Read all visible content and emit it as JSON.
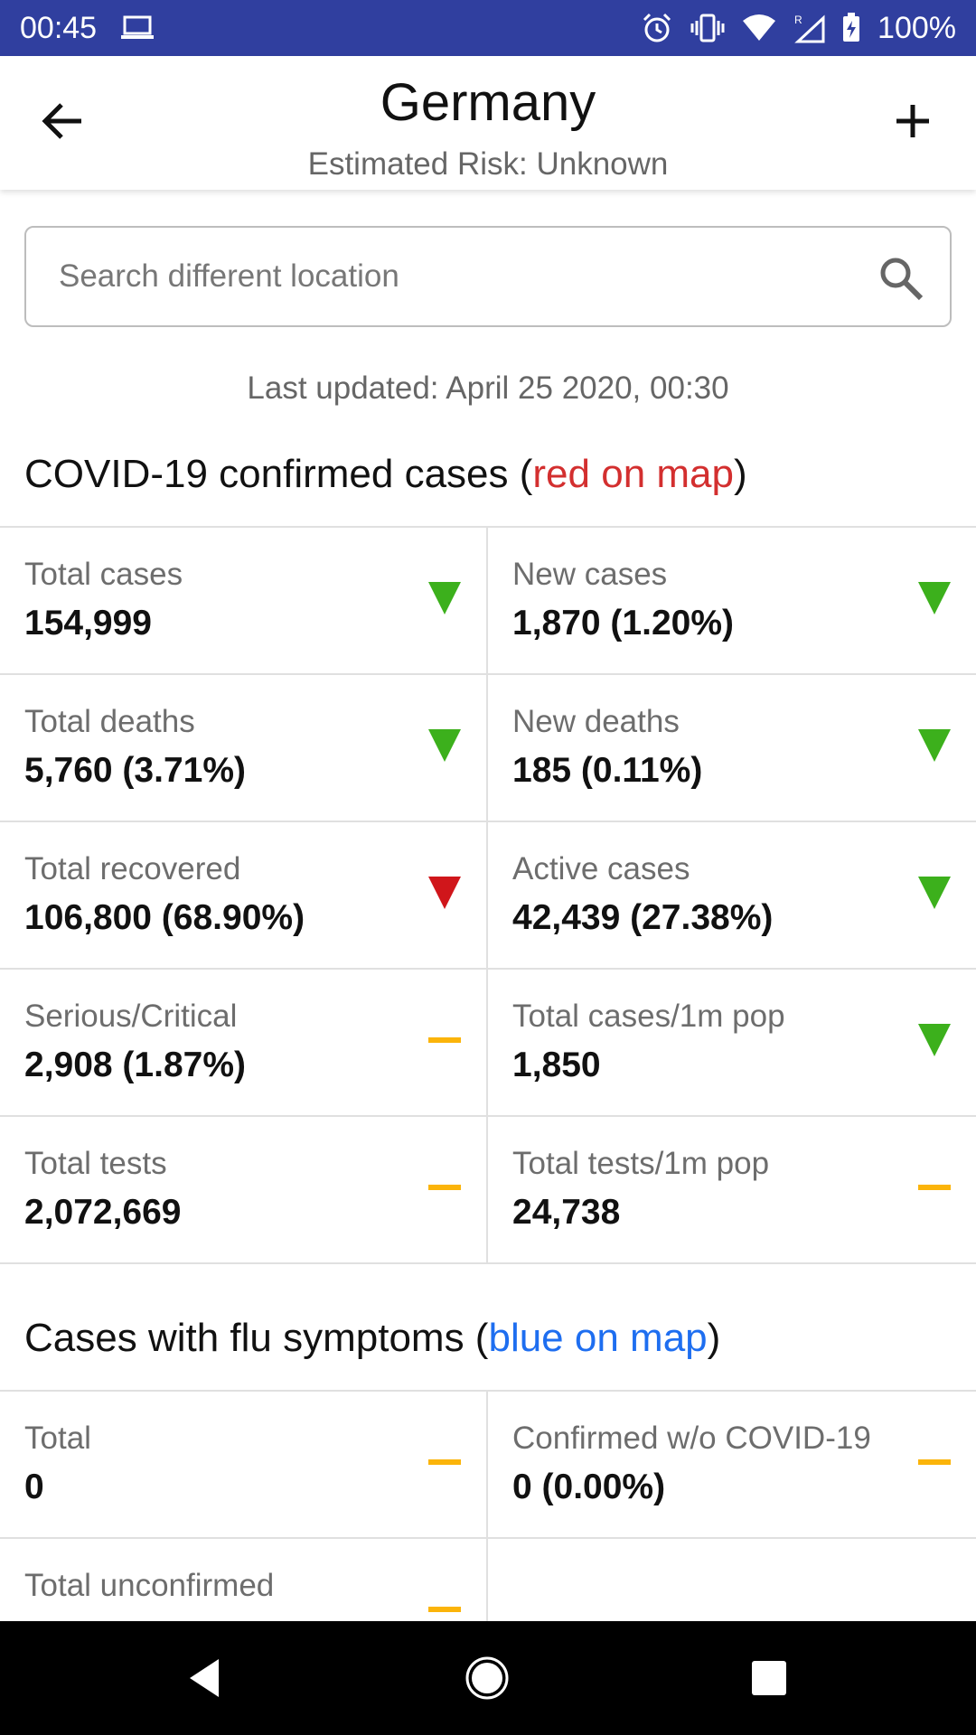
{
  "status_bar": {
    "time": "00:45",
    "battery": "100%",
    "icons": [
      "laptop-icon",
      "alarm-icon",
      "vibrate-icon",
      "wifi-icon",
      "signal-roaming-icon",
      "battery-charging-icon"
    ]
  },
  "header": {
    "title": "Germany",
    "subtitle": "Estimated Risk: Unknown",
    "back_icon": "arrow-back-icon",
    "add_icon": "plus-icon"
  },
  "search": {
    "placeholder": "Search different location",
    "icon": "search-icon"
  },
  "last_updated": "Last updated: April 25 2020, 00:30",
  "covid_section": {
    "title_prefix": "COVID-19 confirmed cases (",
    "title_highlight": "red on map",
    "title_suffix": ")",
    "highlight_color": "#d32f2f",
    "stats": [
      {
        "label": "Total cases",
        "value": "154,999",
        "trend": "down-green"
      },
      {
        "label": "New cases",
        "value": "1,870 (1.20%)",
        "trend": "down-green"
      },
      {
        "label": "Total deaths",
        "value": "5,760 (3.71%)",
        "trend": "down-green"
      },
      {
        "label": "New deaths",
        "value": "185 (0.11%)",
        "trend": "down-green"
      },
      {
        "label": "Total recovered",
        "value": "106,800 (68.90%)",
        "trend": "down-red"
      },
      {
        "label": "Active cases",
        "value": "42,439 (27.38%)",
        "trend": "down-green"
      },
      {
        "label": "Serious/Critical",
        "value": "2,908 (1.87%)",
        "trend": "flat-orange"
      },
      {
        "label": "Total cases/1m pop",
        "value": "1,850",
        "trend": "down-green"
      },
      {
        "label": "Total tests",
        "value": "2,072,669",
        "trend": "flat-orange"
      },
      {
        "label": "Total tests/1m pop",
        "value": "24,738",
        "trend": "flat-orange"
      }
    ]
  },
  "flu_section": {
    "title_prefix": "Cases with flu symptoms (",
    "title_highlight": "blue on map",
    "title_suffix": ")",
    "highlight_color": "#1e6ef0",
    "stats": [
      {
        "label": "Total",
        "value": "0",
        "trend": "flat-orange"
      },
      {
        "label": "Confirmed w/o COVID-19",
        "value": "0 (0.00%)",
        "trend": "flat-orange"
      },
      {
        "label": "Total unconfirmed",
        "value": "",
        "trend": "flat-orange"
      }
    ]
  },
  "colors": {
    "status_bar": "#303f9f",
    "trend_green": "#3cb01c",
    "trend_red": "#d0161b",
    "trend_orange": "#fbb40a"
  },
  "nav_bar": {
    "icons": [
      "nav-back-icon",
      "nav-home-icon",
      "nav-recents-icon"
    ]
  }
}
